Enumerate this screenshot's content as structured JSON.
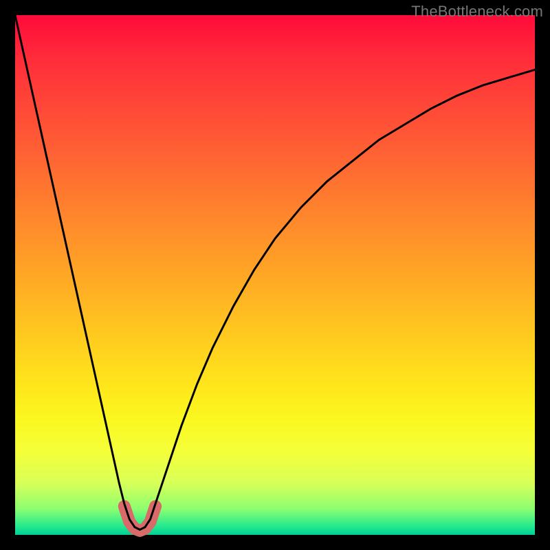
{
  "watermark": "TheBottleneck.com",
  "chart_data": {
    "type": "line",
    "title": "",
    "xlabel": "",
    "ylabel": "",
    "xlim": [
      0,
      100
    ],
    "ylim": [
      0,
      100
    ],
    "grid": false,
    "legend": false,
    "series": [
      {
        "name": "left-curve",
        "x": [
          0,
          2,
          4,
          6,
          8,
          10,
          12,
          14,
          16,
          18,
          20,
          21,
          22,
          23,
          24
        ],
        "values": [
          100,
          91,
          82,
          73,
          64,
          55,
          46,
          37,
          28,
          19,
          10,
          6,
          3,
          1.5,
          1
        ]
      },
      {
        "name": "right-curve",
        "x": [
          24,
          25,
          26,
          27,
          28,
          30,
          32,
          35,
          38,
          42,
          46,
          50,
          55,
          60,
          65,
          70,
          75,
          80,
          85,
          90,
          95,
          100
        ],
        "values": [
          1,
          1.5,
          3,
          6,
          9,
          15,
          21,
          29,
          36,
          44,
          51,
          57,
          63,
          68,
          72,
          76,
          79,
          82,
          84.5,
          86.5,
          88,
          89.5
        ]
      },
      {
        "name": "valley-marker",
        "x": [
          21,
          22,
          23,
          24,
          25,
          26,
          27
        ],
        "values": [
          5.5,
          2.5,
          1.2,
          0.8,
          1.2,
          2.5,
          5.5
        ]
      }
    ],
    "colors": {
      "background_top": "#ff0a3a",
      "background_bottom": "#00d097",
      "curve": "#000000",
      "valley_marker": "#d96a6a"
    }
  }
}
